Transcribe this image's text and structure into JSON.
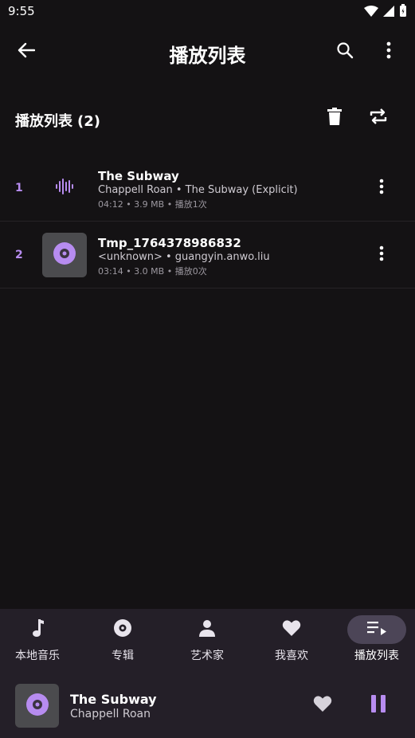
{
  "status_bar": {
    "time": "9:55"
  },
  "app_bar": {
    "title": "播放列表"
  },
  "section": {
    "title": "播放列表",
    "count": "(2)"
  },
  "tracks": [
    {
      "index": "1",
      "title": "The Subway",
      "subtitle": "Chappell Roan • The Subway (Explicit)",
      "meta": "04:12 • 3.9 MB • 播放1次",
      "icon": "now-playing-waveform-icon"
    },
    {
      "index": "2",
      "title": "Tmp_1764378986832",
      "subtitle": "<unknown> • guangyin.anwo.liu",
      "meta": "03:14 • 3.0 MB • 播放0次",
      "icon": "disc-icon"
    }
  ],
  "bottom_nav": {
    "items": [
      {
        "label": "本地音乐",
        "icon": "music-note-icon"
      },
      {
        "label": "专辑",
        "icon": "album-icon"
      },
      {
        "label": "艺术家",
        "icon": "person-icon"
      },
      {
        "label": "我喜欢",
        "icon": "heart-icon"
      },
      {
        "label": "播放列表",
        "icon": "playlist-icon",
        "active": true
      }
    ]
  },
  "mini_player": {
    "title": "The Subway",
    "artist": "Chappell Roan"
  },
  "colors": {
    "accent": "#b78cf0",
    "background": "#141214",
    "nav_bg": "#241f28",
    "active_pill": "#4c4557"
  }
}
